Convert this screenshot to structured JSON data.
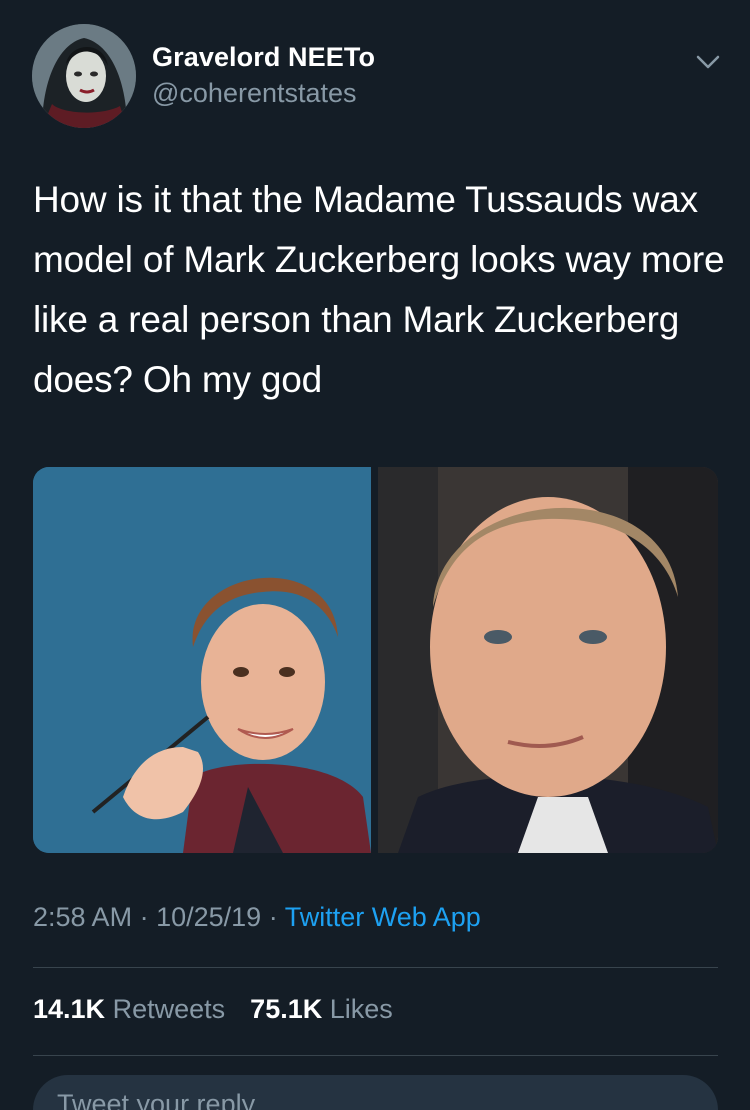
{
  "user": {
    "display_name": "Gravelord NEETo",
    "handle": "@coherentstates"
  },
  "tweet": {
    "text": "How is it that the Madame Tussauds wax model of Mark Zuckerberg looks way more like a real person than Mark Zuckerberg does? Oh my god"
  },
  "meta": {
    "time": "2:58 AM",
    "date": "10/25/19",
    "source": "Twitter Web App"
  },
  "stats": {
    "retweets_count": "14.1K",
    "retweets_label": "Retweets",
    "likes_count": "75.1K",
    "likes_label": "Likes"
  },
  "reply": {
    "placeholder": "Tweet your reply"
  },
  "colors": {
    "background": "#141d26",
    "text_secondary": "#8899a6",
    "link": "#1da1f2"
  },
  "icons": {
    "menu": "chevron-down-icon"
  }
}
